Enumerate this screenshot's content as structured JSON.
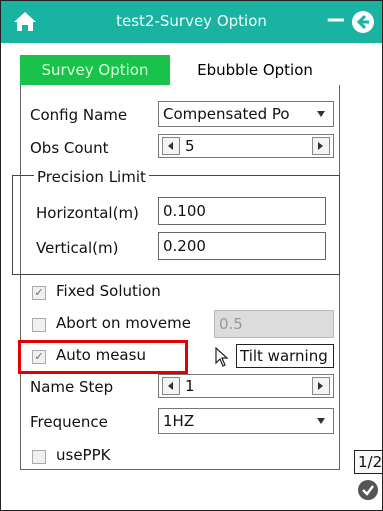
{
  "window": {
    "title": "test2-Survey Option",
    "home_icon": "home-icon",
    "minimize_icon": "minus-icon",
    "back_icon": "back-arrow-icon",
    "minimize_glyph": "−",
    "accent_color": "#1ab2a1"
  },
  "tabs": [
    {
      "label": "Survey Option",
      "active": true,
      "color": "#18c24b"
    },
    {
      "label": "Ebubble Option",
      "active": false
    }
  ],
  "form": {
    "config_name": {
      "label": "Config Name",
      "value": "Compensated Po"
    },
    "obs_count": {
      "label": "Obs Count",
      "value": "5"
    },
    "precision_limit": {
      "title": "Precision Limit",
      "horizontal": {
        "label": "Horizontal(m)",
        "value": "0.100"
      },
      "vertical": {
        "label": "Vertical(m)",
        "value": "0.200"
      }
    },
    "fixed_solution": {
      "label": "Fixed Solution",
      "checked": true
    },
    "abort_on_movement": {
      "label": "Abort on moveme",
      "checked": false,
      "value": "0.5"
    },
    "auto_measure": {
      "label": "Auto measu",
      "checked": true
    },
    "tilt_warning": {
      "label": "Tilt warning",
      "checked": false
    },
    "name_step": {
      "label": "Name Step",
      "value": "1"
    },
    "frequence": {
      "label": "Frequence",
      "value": "1HZ"
    },
    "use_ppk": {
      "label": "usePPK",
      "checked": false
    }
  },
  "footer": {
    "page_label": "1/2",
    "ok_icon": "checkmark-circle-icon"
  },
  "highlight_color": "#e00000"
}
